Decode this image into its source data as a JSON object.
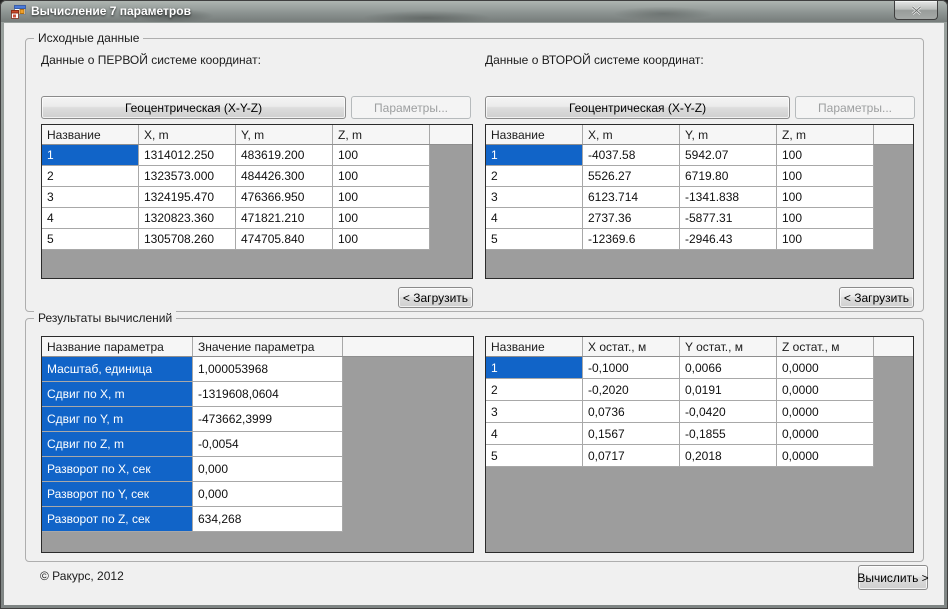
{
  "window": {
    "title": "Вычисление 7 параметров"
  },
  "colors": {
    "selection": "#1164c8",
    "filler": "#9d9d9d"
  },
  "source": {
    "label": "Исходные данные",
    "left": {
      "caption": "Данные о ПЕРВОЙ системе координат:",
      "system_button": "Геоцентрическая (X-Y-Z)",
      "params_button": "Параметры...",
      "load_button": "< Загрузить",
      "table": {
        "headers": [
          "Название",
          "X, m",
          "Y, m",
          "Z, m"
        ],
        "rows": [
          [
            "1",
            "1314012.250",
            "483619.200",
            "100"
          ],
          [
            "2",
            "1323573.000",
            "484426.300",
            "100"
          ],
          [
            "3",
            "1324195.470",
            "476366.950",
            "100"
          ],
          [
            "4",
            "1320823.360",
            "471821.210",
            "100"
          ],
          [
            "5",
            "1305708.260",
            "474705.840",
            "100"
          ]
        ]
      }
    },
    "right": {
      "caption": "Данные о ВТОРОЙ системе координат:",
      "system_button": "Геоцентрическая (X-Y-Z)",
      "params_button": "Параметры...",
      "load_button": "< Загрузить",
      "table": {
        "headers": [
          "Название",
          "X, m",
          "Y, m",
          "Z, m"
        ],
        "rows": [
          [
            "1",
            "-4037.58",
            "5942.07",
            "100"
          ],
          [
            "2",
            "5526.27",
            "6719.80",
            "100"
          ],
          [
            "3",
            "6123.714",
            "-1341.838",
            "100"
          ],
          [
            "4",
            "2737.36",
            "-5877.31",
            "100"
          ],
          [
            "5",
            "-12369.6",
            "-2946.43",
            "100"
          ]
        ]
      }
    }
  },
  "results": {
    "label": "Результаты вычислений",
    "params_table": {
      "headers": [
        "Название параметра",
        "Значение параметра"
      ],
      "rows": [
        [
          "Масштаб, единица",
          "1,000053968"
        ],
        [
          "Сдвиг по X, m",
          "-1319608,0604"
        ],
        [
          "Сдвиг по Y, m",
          "-473662,3999"
        ],
        [
          "Сдвиг по Z, m",
          "-0,0054"
        ],
        [
          "Разворот по X, сек",
          "0,000"
        ],
        [
          "Разворот по Y, сек",
          "0,000"
        ],
        [
          "Разворот по Z, сек",
          "634,268"
        ]
      ]
    },
    "residuals_table": {
      "headers": [
        "Название",
        "X остат., м",
        "Y остат., м",
        "Z остат., м"
      ],
      "rows": [
        [
          "1",
          "-0,1000",
          "0,0066",
          "0,0000"
        ],
        [
          "2",
          "-0,2020",
          "0,0191",
          "0,0000"
        ],
        [
          "3",
          "0,0736",
          "-0,0420",
          "0,0000"
        ],
        [
          "4",
          "0,1567",
          "-0,1855",
          "0,0000"
        ],
        [
          "5",
          "0,0717",
          "0,2018",
          "0,0000"
        ]
      ]
    }
  },
  "footer": {
    "copyright": "© Ракурс, 2012",
    "compute_button": "Вычислить >"
  }
}
